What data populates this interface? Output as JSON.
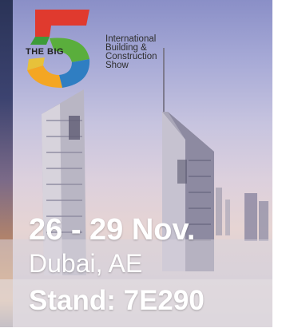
{
  "logo": {
    "the_big": "THE BIG",
    "digit": "5",
    "tagline": [
      "International",
      "Building &",
      "Construction",
      "Show"
    ]
  },
  "event": {
    "dates": "26 - 29 Nov.",
    "location": "Dubai, AE",
    "stand": "Stand: 7E290"
  },
  "colors": {
    "logo_red": "#e03a2e",
    "logo_green": "#5aae3c",
    "logo_blue": "#2f7ec2",
    "logo_orange": "#f4a623",
    "text": "#ffffff"
  }
}
